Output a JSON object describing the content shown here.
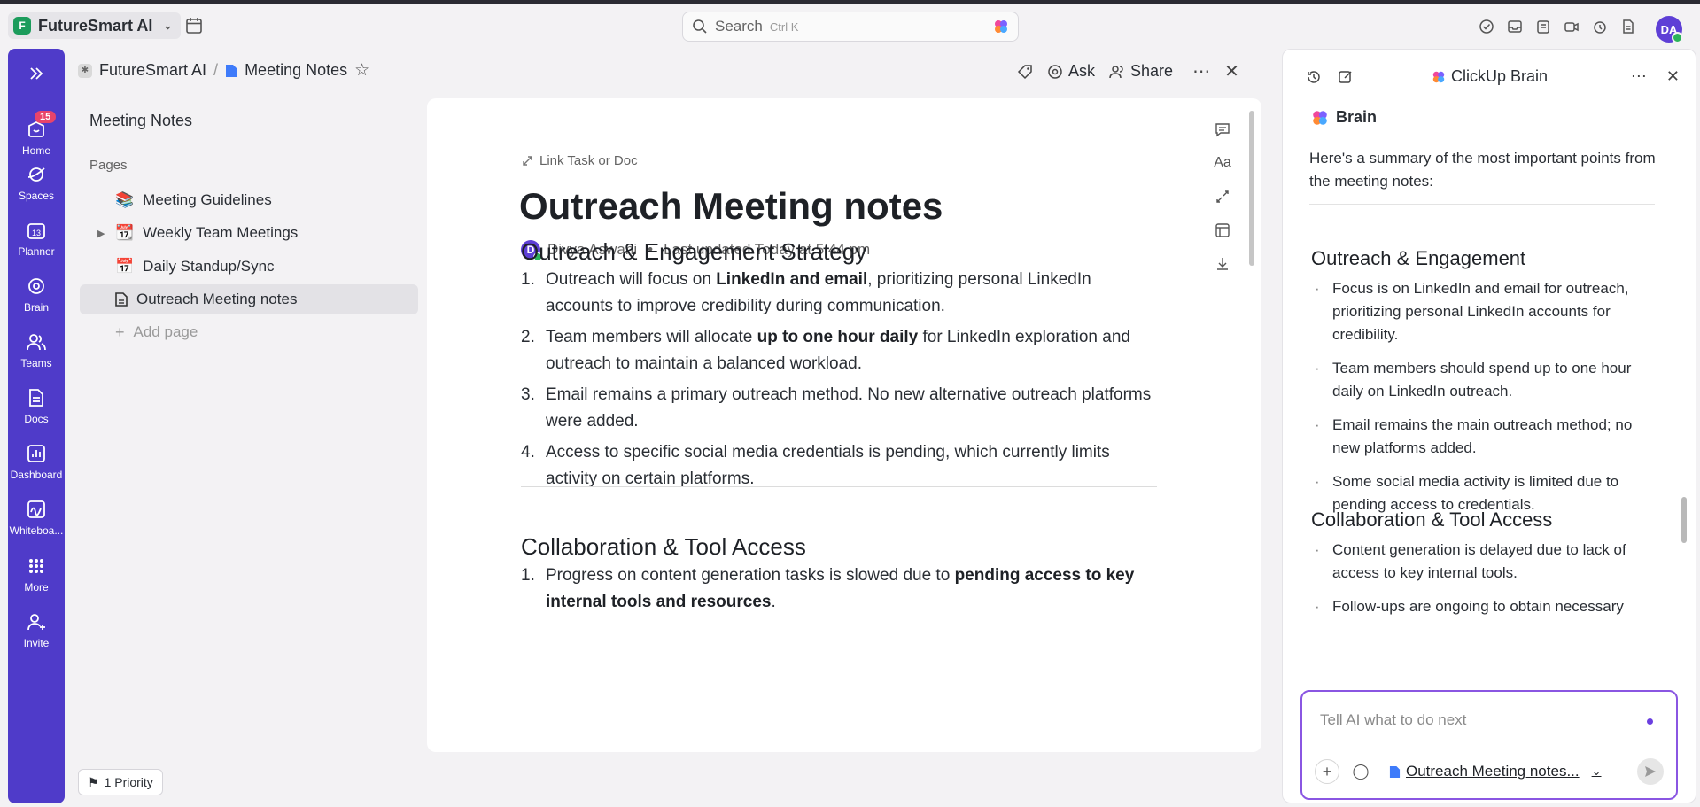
{
  "workspace": {
    "logo_letter": "F",
    "name": "FutureSmart AI"
  },
  "search": {
    "placeholder": "Search",
    "shortcut": "Ctrl K"
  },
  "user": {
    "initials": "DA"
  },
  "rail": {
    "items": [
      {
        "label": "Home",
        "icon": "home-icon",
        "badge": "15"
      },
      {
        "label": "Spaces",
        "icon": "spaces-icon"
      },
      {
        "label": "Planner",
        "icon": "calendar-13-icon",
        "day": "13"
      },
      {
        "label": "Brain",
        "icon": "brain-icon"
      },
      {
        "label": "Teams",
        "icon": "teams-icon"
      },
      {
        "label": "Docs",
        "icon": "docs-icon"
      },
      {
        "label": "Dashboard",
        "icon": "dashboard-icon"
      },
      {
        "label": "Whiteboa...",
        "icon": "whiteboard-icon"
      },
      {
        "label": "More",
        "icon": "grid-icon"
      },
      {
        "label": "Invite",
        "icon": "invite-icon"
      }
    ]
  },
  "breadcrumb": {
    "space": "FutureSmart AI",
    "separator": "/",
    "doc": "Meeting Notes"
  },
  "actions": {
    "ask": "Ask",
    "share": "Share"
  },
  "pages_panel": {
    "title": "Meeting Notes",
    "section_label": "Pages",
    "items": [
      {
        "label": "Meeting Guidelines",
        "emoji": "📚"
      },
      {
        "label": "Weekly Team Meetings",
        "emoji": "📆"
      },
      {
        "label": "Daily Standup/Sync",
        "emoji": "📅"
      },
      {
        "label": "Outreach Meeting notes"
      }
    ],
    "add_label": "Add page"
  },
  "priority": {
    "label": "1 Priority"
  },
  "doc": {
    "link_task": "Link Task or Doc",
    "title": "Outreach Meeting notes",
    "author_initial": "D",
    "author": "Divya Aswani",
    "meta_sep": "•",
    "updated": "Last updated Today at 5:44 pm",
    "section1": {
      "heading": "Outreach & Engagement Strategy",
      "items": [
        {
          "num": "1.",
          "pre": "Outreach will focus on ",
          "bold": "LinkedIn and email",
          "post": ", prioritizing personal LinkedIn accounts to improve credibility during communication."
        },
        {
          "num": "2.",
          "pre": "Team members will allocate ",
          "bold": "up to one hour daily",
          "post": " for LinkedIn exploration and outreach to maintain a balanced workload."
        },
        {
          "num": "3.",
          "pre": "Email remains a primary outreach method. No new alternative outreach platforms were added.",
          "bold": "",
          "post": ""
        },
        {
          "num": "4.",
          "pre": "Access to specific social media credentials is pending, which currently limits activity on certain platforms.",
          "bold": "",
          "post": ""
        }
      ]
    },
    "section2": {
      "heading": "Collaboration & Tool Access",
      "items": [
        {
          "num": "1.",
          "pre": "Progress on content generation tasks is slowed due to ",
          "bold": "pending access to key internal tools and resources",
          "post": "."
        }
      ]
    }
  },
  "brain": {
    "title": "ClickUp Brain",
    "sender": "Brain",
    "intro": "Here's a summary of the most important points from the meeting notes:",
    "section1": {
      "heading": "Outreach & Engagement",
      "bullets": [
        "Focus is on LinkedIn and email for outreach, prioritizing personal LinkedIn accounts for credibility.",
        "Team members should spend up to one hour daily on LinkedIn outreach.",
        "Email remains the main outreach method; no new platforms added.",
        "Some social media activity is limited due to pending access to credentials."
      ]
    },
    "section2": {
      "heading": "Collaboration & Tool Access",
      "bullets": [
        "Content generation is delayed due to lack of access to key internal tools.",
        "Follow-ups are ongoing to obtain necessary"
      ]
    },
    "composer": {
      "placeholder": "Tell AI what to do next",
      "context": "Outreach Meeting notes..."
    }
  },
  "colors": {
    "rail": "#4f3bc9",
    "accent": "#8a56e2",
    "online": "#2bb35a"
  }
}
